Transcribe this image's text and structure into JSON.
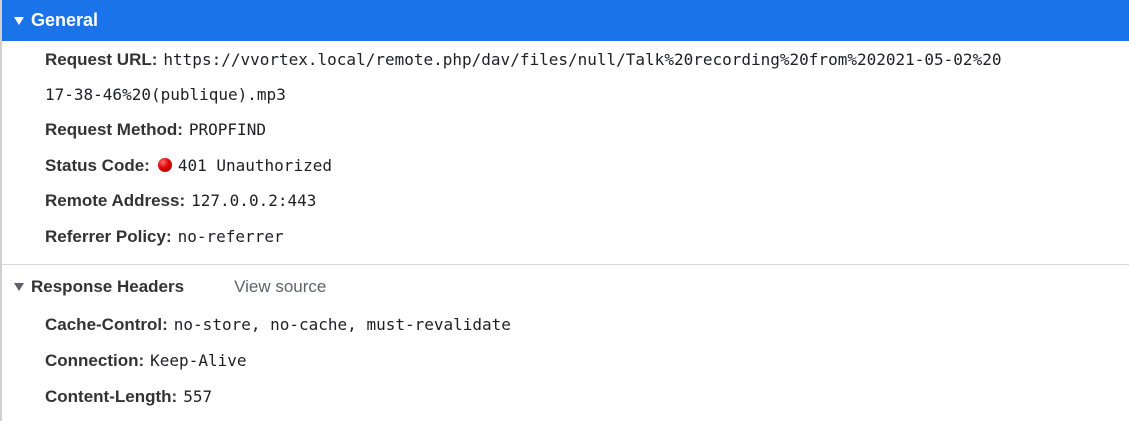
{
  "general": {
    "title": "General",
    "request_url_key": "Request URL:",
    "request_url_line1": "https://vvortex.local/remote.php/dav/files/null/Talk%20recording%20from%202021-05-02%20",
    "request_url_line2": "17-38-46%20(publique).mp3",
    "request_method_key": "Request Method:",
    "request_method": "PROPFIND",
    "status_code_key": "Status Code:",
    "status_code": "401 Unauthorized",
    "status_color": "#e00000",
    "remote_address_key": "Remote Address:",
    "remote_address": "127.0.0.2:443",
    "referrer_policy_key": "Referrer Policy:",
    "referrer_policy": "no-referrer"
  },
  "response_headers": {
    "title": "Response Headers",
    "view_source": "View source",
    "cache_control_key": "Cache-Control:",
    "cache_control": "no-store, no-cache, must-revalidate",
    "connection_key": "Connection:",
    "connection": "Keep-Alive",
    "content_length_key": "Content-Length:",
    "content_length": "557"
  },
  "colors": {
    "header_bg": "#1a73e8",
    "status_dot": "#e00000"
  }
}
